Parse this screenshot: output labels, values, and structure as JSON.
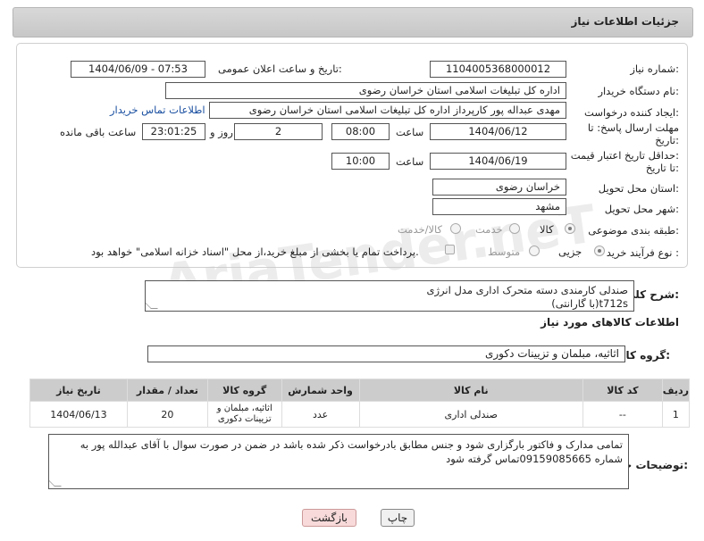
{
  "header": {
    "title": "جزئیات اطلاعات نیاز"
  },
  "form": {
    "need_number_label": "شماره نیاز:",
    "need_number": "1104005368000012",
    "announce_label": "تاریخ و ساعت اعلان عمومی:",
    "announce_value": "1404/06/09 - 07:53",
    "buyer_org_label": "نام دستگاه خریدار:",
    "buyer_org": "اداره کل تبلیغات اسلامی استان خراسان رضوی",
    "creator_label": "ایجاد کننده درخواست:",
    "creator": "مهدی عبداله پور کارپرداز اداره کل تبلیغات اسلامی استان خراسان رضوی",
    "contact_link": "اطلاعات تماس خریدار",
    "reply_deadline_label_1": "مهلت ارسال پاسخ: تا",
    "reply_deadline_label_2": "تاریخ:",
    "reply_date": "1404/06/12",
    "time_label": "ساعت",
    "reply_time": "08:00",
    "days_value": "2",
    "days_label": "روز و",
    "remaining_time": "23:01:25",
    "remaining_label": "ساعت باقی مانده",
    "price_deadline_label_1": "حداقل تاریخ اعتبار قیمت:",
    "price_deadline_label_2": "تا تاریخ:",
    "price_date": "1404/06/19",
    "price_time": "10:00",
    "province_label": "استان محل تحویل:",
    "province": "خراسان رضوی",
    "city_label": "شهر محل تحویل:",
    "city": "مشهد",
    "category_label": "طبقه بندی موضوعی:",
    "category_options": [
      "کالا",
      "خدمت",
      "کالا/خدمت"
    ],
    "process_label": "نوع فرآیند خرید :",
    "process_options": [
      "جزیی",
      "متوسط"
    ],
    "payment_note": "پرداخت تمام یا بخشی از مبلغ خرید،از محل \"اسناد خزانه اسلامی\" خواهد بود."
  },
  "description": {
    "label": "شرح کلی نیاز:",
    "line1": "صندلی کارمندی دسته متحرک اداری مدل انرژی",
    "line2": "t712s(با گارانتی)"
  },
  "goods": {
    "section_title": "اطلاعات کالاهای مورد نیاز",
    "group_label": "گروه کالا:",
    "group_value": "اثاثیه، مبلمان و تزیینات دکوری",
    "columns": [
      "ردیف",
      "کد کالا",
      "نام کالا",
      "واحد شمارش",
      "گروه کالا",
      "تعداد / مقدار",
      "تاریخ نیاز"
    ],
    "rows": [
      [
        "1",
        "--",
        "صندلی اداری",
        "عدد",
        "اثاثیه، مبلمان و تزیینات دکوری",
        "20",
        "1404/06/13"
      ]
    ]
  },
  "buyer_notes": {
    "label": "توضیحات خریدار:",
    "text": "تمامی مدارک و فاکتور بارگزاری شود و جنس مطابق بادرخواست ذکر شده باشد در ضمن در صورت سوال  با آقای عبدالله پور به شماره 09159085665تماس گرفته شود"
  },
  "buttons": {
    "print": "چاپ",
    "back": "بازگشت"
  },
  "colors": {
    "back_button_bg": "#f8dada",
    "print_button_bg": "#f0f0f0",
    "link": "#1a4fa0"
  }
}
